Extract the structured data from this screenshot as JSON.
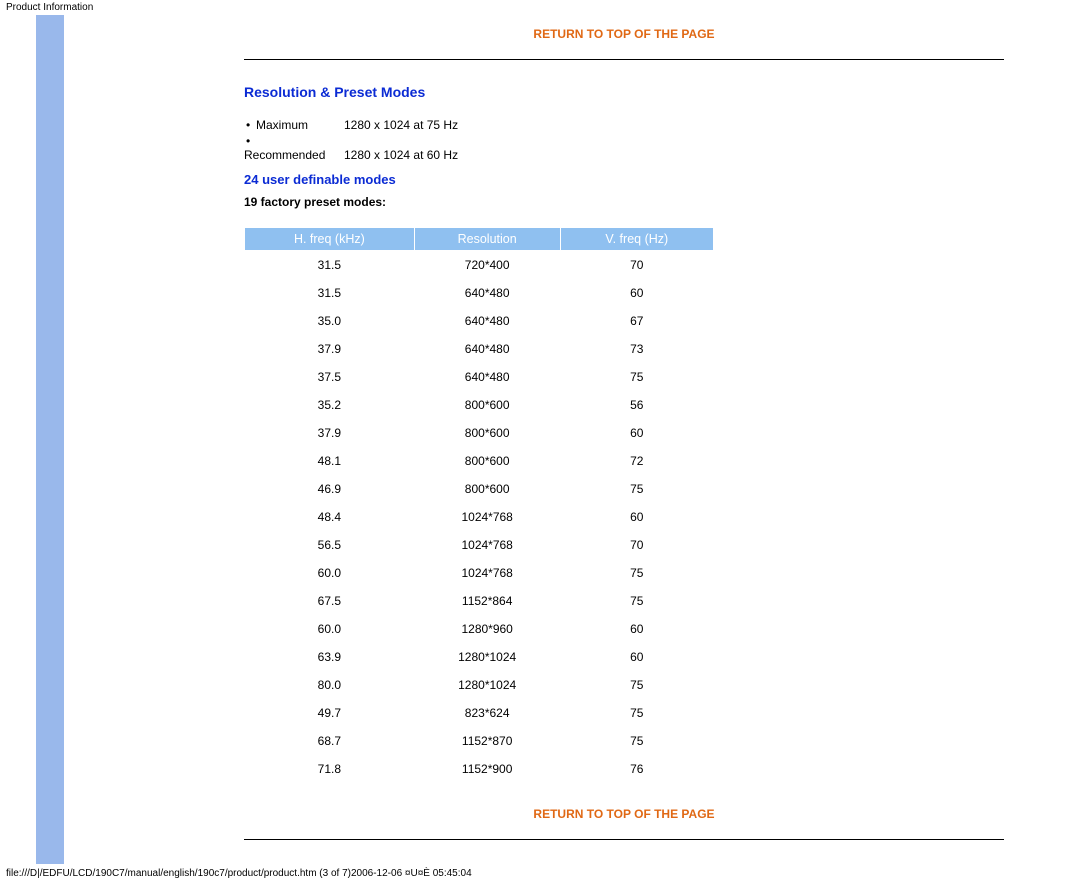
{
  "page_header": "Product Information",
  "return_top": "RETURN TO TOP OF THE PAGE",
  "section_title": "Resolution & Preset Modes",
  "specs": [
    {
      "label": "Maximum",
      "value": "1280 x 1024 at 75 Hz"
    },
    {
      "label": "Recommended",
      "value": "1280 x 1024 at 60 Hz"
    }
  ],
  "sub_title": "24 user definable modes",
  "factory_title": "19 factory preset modes:",
  "chart_data": {
    "type": "table",
    "columns": [
      "H. freq (kHz)",
      "Resolution",
      "V. freq (Hz)"
    ],
    "rows": [
      [
        "31.5",
        "720*400",
        "70"
      ],
      [
        "31.5",
        "640*480",
        "60"
      ],
      [
        "35.0",
        "640*480",
        "67"
      ],
      [
        "37.9",
        "640*480",
        "73"
      ],
      [
        "37.5",
        "640*480",
        "75"
      ],
      [
        "35.2",
        "800*600",
        "56"
      ],
      [
        "37.9",
        "800*600",
        "60"
      ],
      [
        "48.1",
        "800*600",
        "72"
      ],
      [
        "46.9",
        "800*600",
        "75"
      ],
      [
        "48.4",
        "1024*768",
        "60"
      ],
      [
        "56.5",
        "1024*768",
        "70"
      ],
      [
        "60.0",
        "1024*768",
        "75"
      ],
      [
        "67.5",
        "1152*864",
        "75"
      ],
      [
        "60.0",
        "1280*960",
        "60"
      ],
      [
        "63.9",
        "1280*1024",
        "60"
      ],
      [
        "80.0",
        "1280*1024",
        "75"
      ],
      [
        "49.7",
        "823*624",
        "75"
      ],
      [
        "68.7",
        "1152*870",
        "75"
      ],
      [
        "71.8",
        "1152*900",
        "76"
      ]
    ]
  },
  "footer_path": "file:///D|/EDFU/LCD/190C7/manual/english/190c7/product/product.htm (3 of 7)2006-12-06 ¤U¤È 05:45:04"
}
